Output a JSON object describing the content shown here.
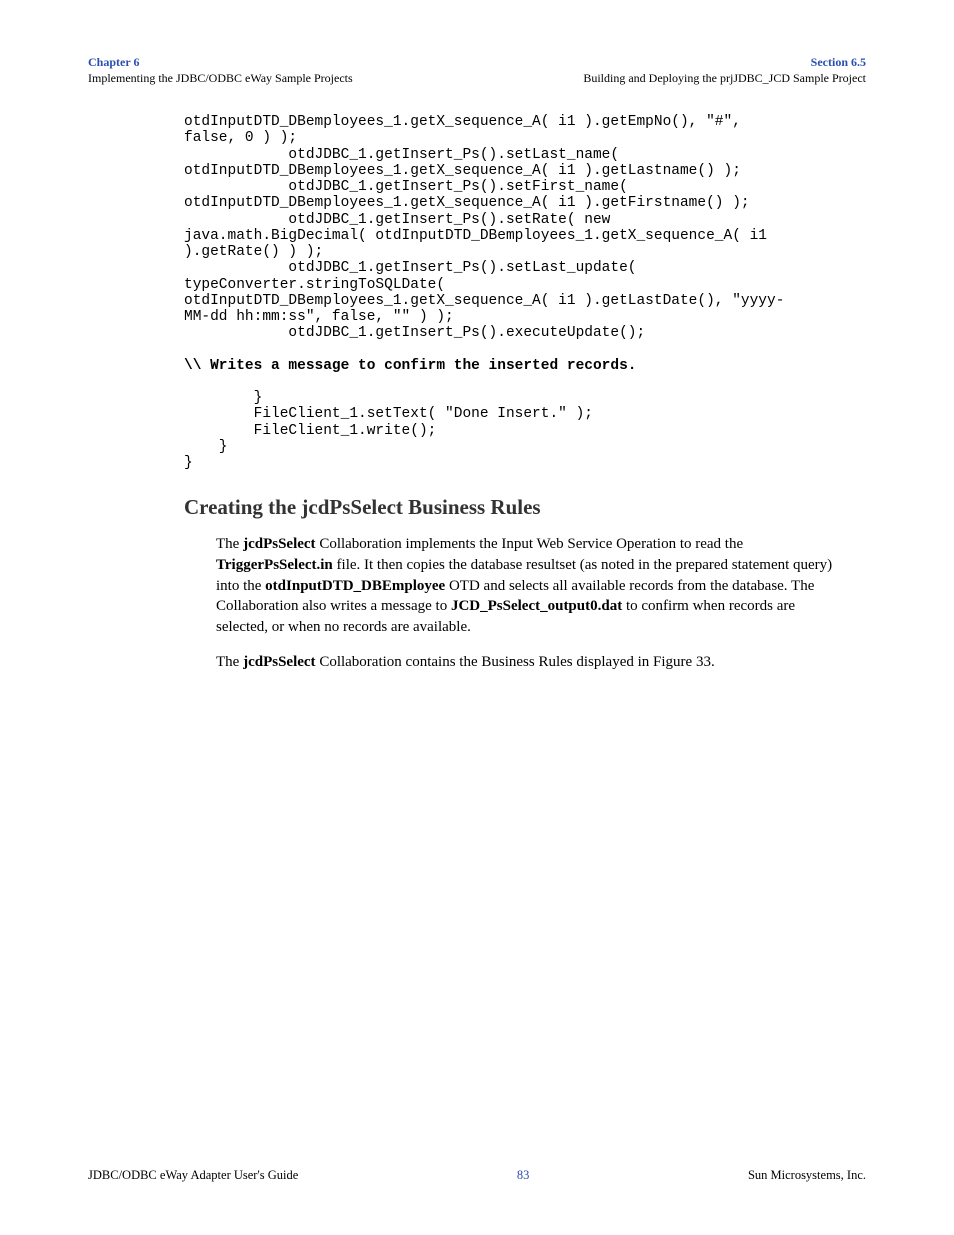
{
  "header": {
    "chapter": "Chapter 6",
    "left_sub": "Implementing the JDBC/ODBC eWay Sample Projects",
    "section": "Section 6.5",
    "right_sub": "Building and Deploying the prjJDBC_JCD Sample Project"
  },
  "code": {
    "part1": "otdInputDTD_DBemployees_1.getX_sequence_A( i1 ).getEmpNo(), \"#\", \nfalse, 0 ) );\n            otdJDBC_1.getInsert_Ps().setLast_name( \notdInputDTD_DBemployees_1.getX_sequence_A( i1 ).getLastname() );\n            otdJDBC_1.getInsert_Ps().setFirst_name( \notdInputDTD_DBemployees_1.getX_sequence_A( i1 ).getFirstname() );\n            otdJDBC_1.getInsert_Ps().setRate( new \njava.math.BigDecimal( otdInputDTD_DBemployees_1.getX_sequence_A( i1 \n).getRate() ) );\n            otdJDBC_1.getInsert_Ps().setLast_update( \ntypeConverter.stringToSQLDate( \notdInputDTD_DBemployees_1.getX_sequence_A( i1 ).getLastDate(), \"yyyy-\nMM-dd hh:mm:ss\", false, \"\" ) );\n            otdJDBC_1.getInsert_Ps().executeUpdate();",
    "comment": "\\\\ Writes a message to confirm the inserted records.",
    "part2": "        }\n        FileClient_1.setText( \"Done Insert.\" );\n        FileClient_1.write();\n    }\n}"
  },
  "section_heading": "Creating the jcdPsSelect Business Rules",
  "para1": {
    "t1": "The ",
    "b1": "jcdPsSelect",
    "t2": " Collaboration implements the Input Web Service Operation to read the ",
    "b2": "TriggerPsSelect.in",
    "t3": " file. It then copies the database resultset (as noted in the prepared statement query) into the ",
    "b3": "otdInputDTD_DBEmployee",
    "t4": " OTD and selects all available records from the database. The Collaboration also writes a message to ",
    "b4": "JCD_PsSelect_output0.dat",
    "t5": " to confirm when records are selected, or when no records are available."
  },
  "para2": {
    "t1": "The ",
    "b1": "jcdPsSelect",
    "t2": " Collaboration contains the Business Rules displayed in Figure 33."
  },
  "footer": {
    "left": "JDBC/ODBC eWay Adapter User's Guide",
    "center": "83",
    "right": "Sun Microsystems, Inc."
  }
}
